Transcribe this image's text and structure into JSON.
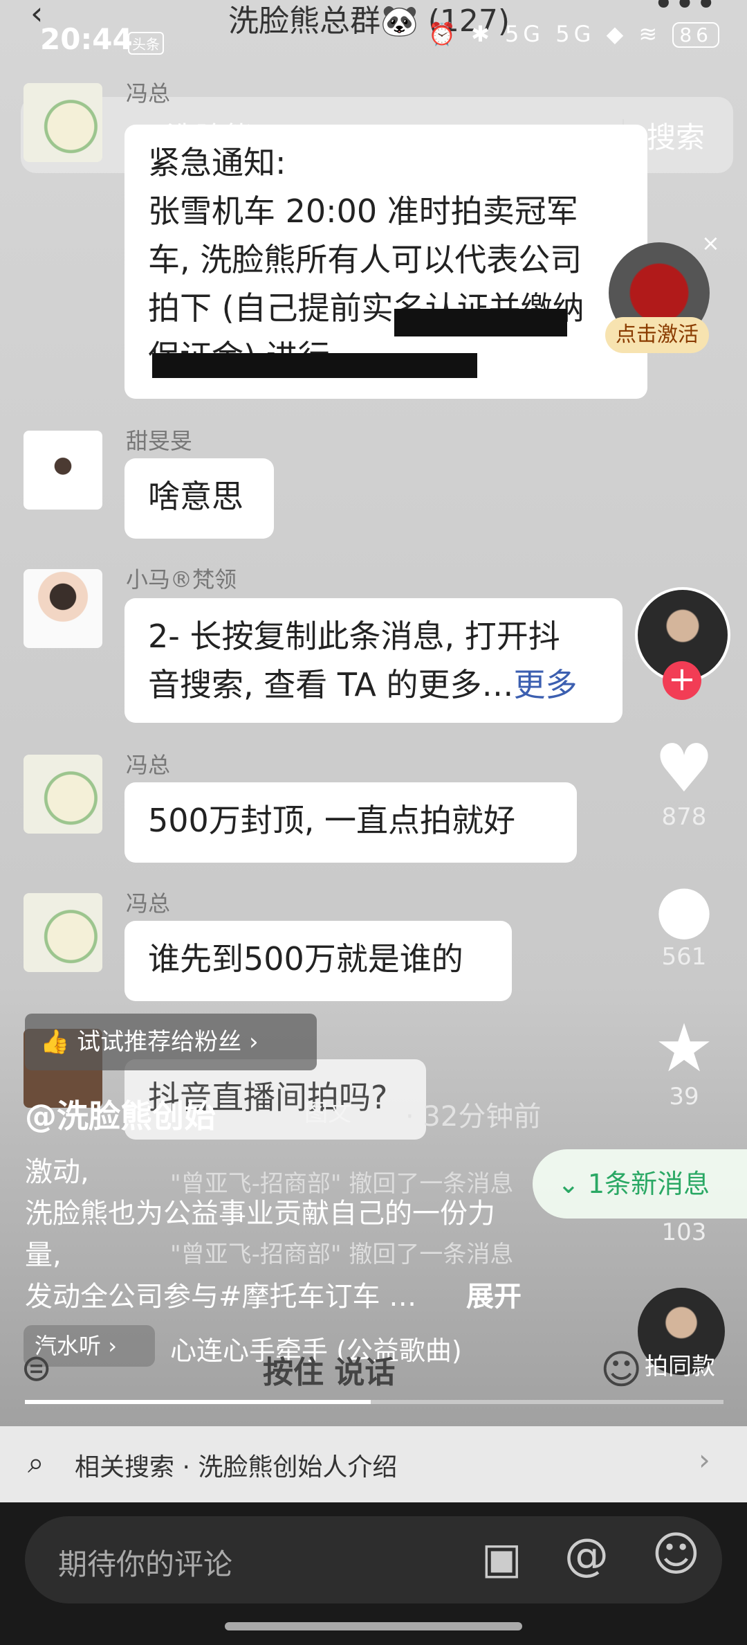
{
  "status_bar": {
    "time": "20:44",
    "app_badge": "头条",
    "icons": "⏰ ✱ 5G 5G ◆ ≋",
    "battery": "86"
  },
  "chat_header": {
    "title": "洗脸熊总群🐼 (127)",
    "more": "•••"
  },
  "search": {
    "query": "洗脸熊",
    "button": "搜索"
  },
  "messages": [
    {
      "name": "冯总",
      "lines": [
        "紧急通知:",
        "张雪机车 20:00 准时拍卖冠军",
        "车, 洗脸熊所有人可以代表公司",
        "拍下 (自己提前实名认证并缴纳",
        "保证金) 进行"
      ]
    },
    {
      "name": "甜旻旻",
      "text": "啥意思"
    },
    {
      "name": "小马®梵领",
      "line1": "2- 长按复制此条消息, 打开抖",
      "line2": "音搜索, 查看 TA 的更多…",
      "more": "更多"
    },
    {
      "name": "冯总",
      "text": "500万封顶, 一直点拍就好"
    },
    {
      "name": "冯总",
      "text": "谁先到500万就是谁的"
    },
    {
      "name": "",
      "text": "抖音直播间拍吗?"
    }
  ],
  "red_packet": {
    "label": "点击激活",
    "close": "×"
  },
  "right_rail": {
    "likes": "878",
    "comments": "561",
    "favorites": "39",
    "shares": "103",
    "same_style": "拍同款"
  },
  "recommend_tip": "试试推荐给粉丝",
  "author": "@洗脸熊创始",
  "image_tag": "图文",
  "time_ago": "· 32分钟前",
  "caption": {
    "line1": "激动,",
    "line2": "洗脸熊也为公益事业贡献自己的一份力",
    "line3": "量,",
    "line4": "发动全公司参与#摩托车订车 …",
    "expand": "展开"
  },
  "recalled": [
    "\"曾亚飞-招商部\" 撤回了一条消息",
    "\"曾亚飞-招商部\" 撤回了一条消息"
  ],
  "new_messages": "1条新消息",
  "music": {
    "tag": "汽水听",
    "title": "心连心手牵手 (公益歌曲)"
  },
  "hold_to_talk": "按住 说话",
  "related_search": "相关搜索 · 洗脸熊创始人介绍",
  "comment_placeholder": "期待你的评论"
}
